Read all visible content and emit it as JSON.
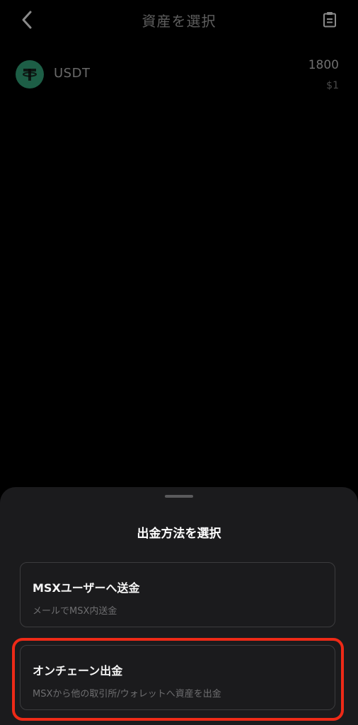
{
  "header": {
    "title": "資産を選択",
    "back_icon": "chevron-left-icon",
    "history_icon": "clipboard-icon"
  },
  "assets": [
    {
      "symbol": "USDT",
      "amount": "1800",
      "value": "$1",
      "icon": "tether-icon",
      "icon_color": "#1d5e46"
    }
  ],
  "sheet": {
    "title": "出金方法を選択",
    "options": [
      {
        "title": "MSXユーザーへ送金",
        "description": "メールでMSX内送金"
      },
      {
        "title": "オンチェーン出金",
        "description": "MSXから他の取引所/ウォレットへ資産を出金"
      }
    ]
  },
  "colors": {
    "background": "#000000",
    "sheet": "#1b1b1d",
    "highlight": "#ee2a17"
  }
}
